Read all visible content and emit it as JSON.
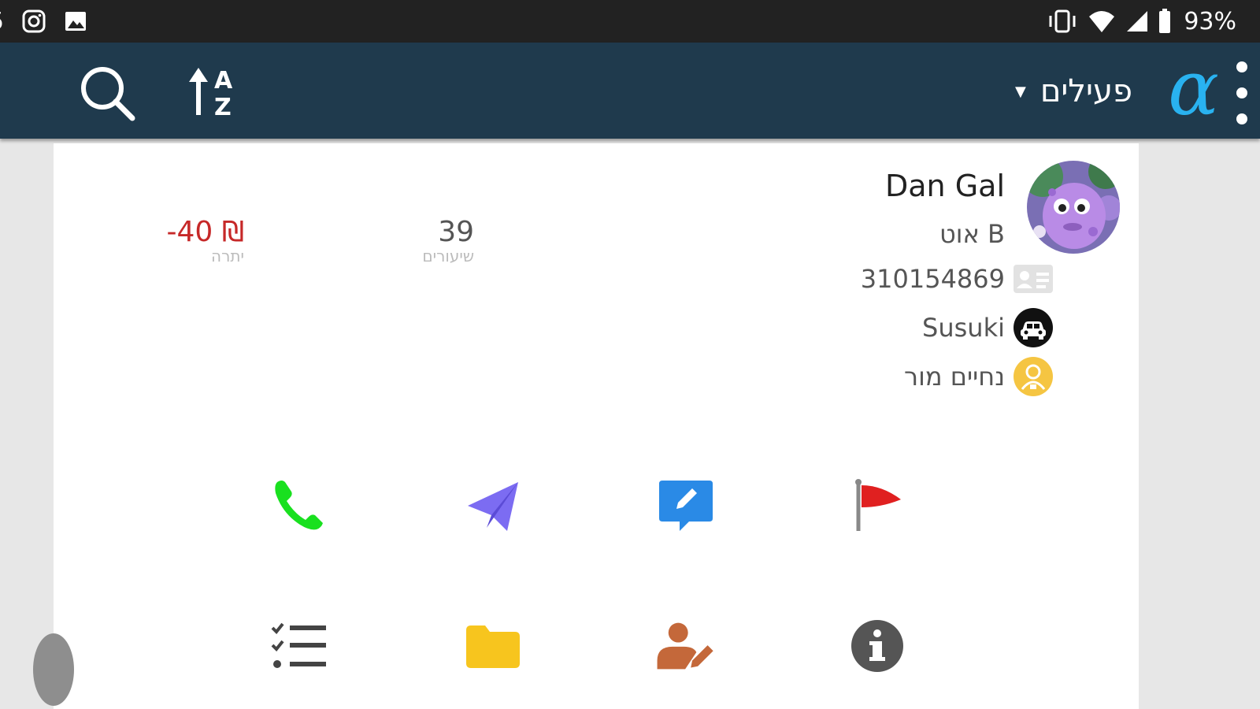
{
  "status_bar": {
    "left_fragment": "5",
    "battery": "93%",
    "icons": [
      "instagram-icon",
      "image-icon",
      "vibrate-icon",
      "wifi-icon",
      "signal-icon",
      "battery-icon"
    ]
  },
  "app_bar": {
    "filter_label": "פעילים",
    "logo": "α",
    "background_color": "#1f3a4d",
    "logo_color": "#29b2f0"
  },
  "student": {
    "name": "Dan Gal",
    "subtitle": "B אוט",
    "id_number": "310154869",
    "vehicle": "Susuki",
    "teacher": "נחיים מור"
  },
  "stats": {
    "lessons_value": "39",
    "lessons_label": "שיעורים",
    "balance_value": "-40 ₪",
    "balance_label": "יתרה",
    "balance_color": "#c62828"
  },
  "actions_row1": [
    "phone-icon",
    "send-icon",
    "note-icon",
    "flag-icon"
  ],
  "actions_row2": [
    "checklist-icon",
    "folder-icon",
    "edit-user-icon",
    "info-icon"
  ]
}
